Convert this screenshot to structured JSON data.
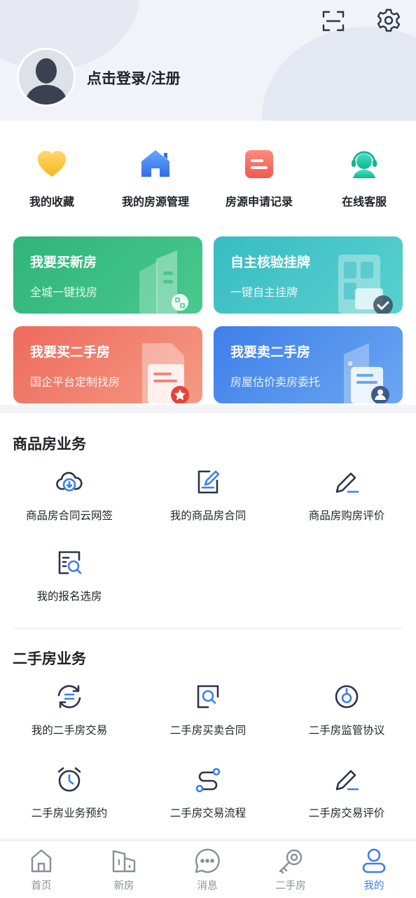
{
  "header": {
    "login_text": "点击登录/注册"
  },
  "quick_actions": [
    {
      "label": "我的收藏",
      "icon": "heart-icon"
    },
    {
      "label": "我的房源管理",
      "icon": "house-icon"
    },
    {
      "label": "房源申请记录",
      "icon": "record-icon"
    },
    {
      "label": "在线客服",
      "icon": "customer-service-icon"
    }
  ],
  "promos": [
    {
      "title": "我要买新房",
      "subtitle": "全城一键找房",
      "color": "#33b97d"
    },
    {
      "title": "自主核验挂牌",
      "subtitle": "一键自主挂牌",
      "color": "#3fc3c6"
    },
    {
      "title": "我要买二手房",
      "subtitle": "国企平台定制找房",
      "color": "#ef7566"
    },
    {
      "title": "我要卖二手房",
      "subtitle": "房屋估价卖房委托",
      "color": "#4a8cee"
    }
  ],
  "commercial": {
    "title": "商品房业务",
    "items": [
      {
        "label": "商品房合同云网签",
        "icon": "cloud-download-icon"
      },
      {
        "label": "我的商品房合同",
        "icon": "edit-document-icon"
      },
      {
        "label": "商品房购房评价",
        "icon": "pencil-icon"
      },
      {
        "label": "我的报名选房",
        "icon": "document-search-icon"
      }
    ]
  },
  "secondhand": {
    "title": "二手房业务",
    "items": [
      {
        "label": "我的二手房交易",
        "icon": "exchange-icon"
      },
      {
        "label": "二手房买卖合同",
        "icon": "search-document-icon"
      },
      {
        "label": "二手房监管协议",
        "icon": "shield-person-icon"
      },
      {
        "label": "二手房业务预约",
        "icon": "alarm-clock-icon"
      },
      {
        "label": "二手房交易流程",
        "icon": "flow-icon"
      },
      {
        "label": "二手房交易评价",
        "icon": "pencil-icon"
      }
    ]
  },
  "tabbar": [
    {
      "label": "首页",
      "icon": "home-icon",
      "active": false
    },
    {
      "label": "新房",
      "icon": "building-icon",
      "active": false
    },
    {
      "label": "消息",
      "icon": "message-icon",
      "active": false
    },
    {
      "label": "二手房",
      "icon": "key-icon",
      "active": false
    },
    {
      "label": "我的",
      "icon": "user-icon",
      "active": true
    }
  ],
  "colors": {
    "accent": "#3c7ef0",
    "icon_dark": "#2c3447",
    "icon_blue": "#3c7ef0"
  }
}
